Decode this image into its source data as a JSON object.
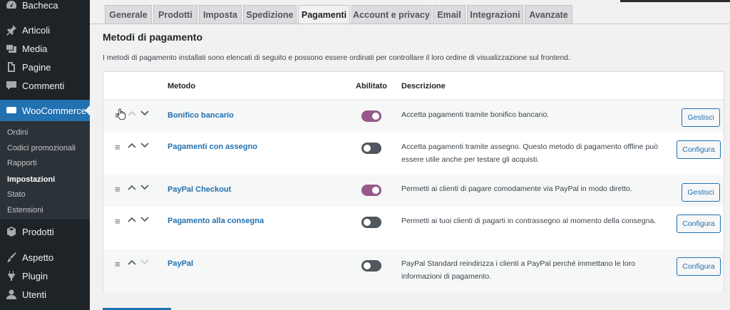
{
  "sidebar": {
    "bacheca": "Bacheca",
    "articoli": "Articoli",
    "media": "Media",
    "pagine": "Pagine",
    "commenti": "Commenti",
    "woocommerce": "WooCommerce",
    "submenu": [
      "Ordini",
      "Codici promozionali",
      "Rapporti",
      "Impostazioni",
      "Stato",
      "Estensioni"
    ],
    "prodotti": "Prodotti",
    "aspetto": "Aspetto",
    "plugin": "Plugin",
    "utenti": "Utenti"
  },
  "tabs": [
    "Generale",
    "Prodotti",
    "Imposta",
    "Spedizione",
    "Pagamenti",
    "Account e privacy",
    "Email",
    "Integrazioni",
    "Avanzate"
  ],
  "page": {
    "title": "Metodi di pagamento",
    "description": "I metodi di pagamento installati sono elencati di seguito e possono essere ordinati per controllare il loro ordine di visualizzazione sul frontend."
  },
  "table": {
    "headers": {
      "metodo": "Metodo",
      "abilitato": "Abilitato",
      "descrizione": "Descrizione"
    },
    "rows": [
      {
        "name": "Bonifico bancario",
        "enabled": true,
        "description": "Accetta pagamenti tramite bonifico bancario.",
        "action": "Gestisci"
      },
      {
        "name": "Pagamenti con assegno",
        "enabled": false,
        "description": "Accetta pagamenti tramite assegno. Questo metodo di pagamento offline può essere utile anche per testare gli acquisti.",
        "action": "Configura"
      },
      {
        "name": "PayPal Checkout",
        "enabled": true,
        "description": "Permetti ai clienti di pagare comodamente via PayPal in modo diretto.",
        "action": "Gestisci"
      },
      {
        "name": "Pagamento alla consegna",
        "enabled": false,
        "description": "Permetti ai tuoi clienti di pagarti in contrassegno al momento della consegna.",
        "action": "Configura"
      },
      {
        "name": "PayPal",
        "enabled": false,
        "description": "PayPal Standard reindirizza i clienti a PayPal perché immettano le loro informazioni di pagamento.",
        "action": "Configura"
      }
    ]
  },
  "colors": {
    "sidebar": "#1d2327",
    "accent": "#2271b1",
    "toggle_on": "#96588a"
  },
  "icons": {
    "handle": "≡"
  }
}
